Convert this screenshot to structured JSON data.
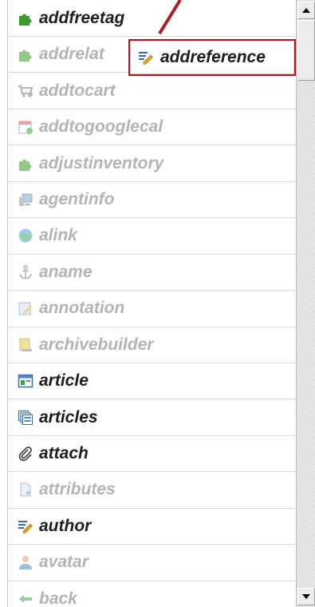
{
  "list": {
    "items": [
      {
        "label": "addfreetag",
        "icon": "puzzle-icon",
        "enabled": true
      },
      {
        "label": "addrelat",
        "icon": "puzzle-icon",
        "enabled": false
      },
      {
        "label": "addtocart",
        "icon": "cart-icon",
        "enabled": false
      },
      {
        "label": "addtogooglecal",
        "icon": "calendar-icon",
        "enabled": false
      },
      {
        "label": "adjustinventory",
        "icon": "puzzle-icon",
        "enabled": false
      },
      {
        "label": "agentinfo",
        "icon": "computer-icon",
        "enabled": false
      },
      {
        "label": "alink",
        "icon": "globe-icon",
        "enabled": false
      },
      {
        "label": "aname",
        "icon": "anchor-icon",
        "enabled": false
      },
      {
        "label": "annotation",
        "icon": "note-pencil-icon",
        "enabled": false
      },
      {
        "label": "archivebuilder",
        "icon": "archive-icon",
        "enabled": false
      },
      {
        "label": "article",
        "icon": "article-icon",
        "enabled": true
      },
      {
        "label": "articles",
        "icon": "articles-icon",
        "enabled": true
      },
      {
        "label": "attach",
        "icon": "paperclip-icon",
        "enabled": true
      },
      {
        "label": "attributes",
        "icon": "document-icon",
        "enabled": false
      },
      {
        "label": "author",
        "icon": "pencil-icon",
        "enabled": true
      },
      {
        "label": "avatar",
        "icon": "person-icon",
        "enabled": false
      },
      {
        "label": "back",
        "icon": "arrow-left-icon",
        "enabled": false
      }
    ]
  },
  "callout": {
    "label": "addreference",
    "icon": "pencil-icon"
  },
  "colors": {
    "accent": "#a61d24",
    "enabled_text": "#1e1e1e",
    "disabled_text": "#b4b4b4"
  }
}
